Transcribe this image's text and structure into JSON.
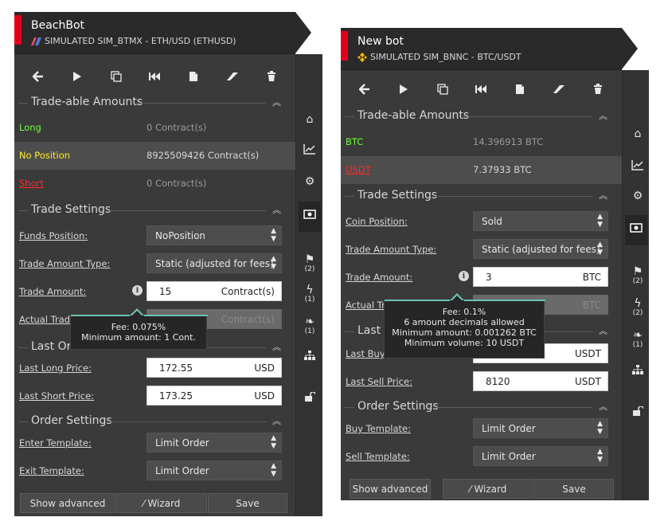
{
  "panels": [
    {
      "title": "BeachBot",
      "exchange": "SIMULATED SIM_BTMX - ETH/USD (ETHUSD)",
      "sections": {
        "amounts": "Trade-able Amounts",
        "settings": "Trade Settings",
        "last": "Last Order",
        "orders": "Order Settings"
      },
      "amounts": [
        {
          "label": "Long",
          "value": "0 Contract(s)",
          "color": "#6dff3a"
        },
        {
          "label": "No Position",
          "value": "8925509426 Contract(s)",
          "color": "#ffef28"
        },
        {
          "label": "Short",
          "value": "0 Contract(s)",
          "color": "#ff2a2a"
        }
      ],
      "fields": {
        "funds_position_label": "Funds Position:",
        "funds_position_value": "NoPosition",
        "trade_amount_type_label": "Trade Amount Type:",
        "trade_amount_type_value": "Static (adjusted for fees)",
        "trade_amount_label": "Trade Amount:",
        "trade_amount_value": "15",
        "trade_amount_unit": "Contract(s)",
        "actual_trade_label": "Actual Trade",
        "actual_trade_unit": "Contract(s)",
        "last_long_label": "Last Long Price:",
        "last_long_value": "172.55",
        "last_long_unit": "USD",
        "last_short_label": "Last Short Price:",
        "last_short_value": "173.25",
        "last_short_unit": "USD",
        "enter_template_label": "Enter Template:",
        "enter_template_value": "Limit Order",
        "exit_template_label": "Exit Template:",
        "exit_template_value": "Limit Order"
      },
      "tooltip": {
        "line1": "Fee: 0.075%",
        "line2": "Minimum amount: 1 Cont."
      },
      "buttons": {
        "advanced": "Show advanced",
        "wizard": "Wizard",
        "save": "Save"
      }
    },
    {
      "title": "New bot",
      "exchange": "SIMULATED SIM_BNNC - BTC/USDT",
      "sections": {
        "amounts": "Trade-able Amounts",
        "settings": "Trade Settings",
        "last": "Last",
        "orders": "Order Settings"
      },
      "amounts": [
        {
          "label": "BTC",
          "value": "14.396913 BTC",
          "color": "#6dff3a"
        },
        {
          "label": "USDT",
          "value": "7.37933 BTC",
          "color": "#ff2a2a"
        }
      ],
      "fields": {
        "coin_position_label": "Coin Position:",
        "coin_position_value": "Sold",
        "trade_amount_type_label": "Trade Amount Type:",
        "trade_amount_type_value": "Static (adjusted for fees)",
        "trade_amount_label": "Trade Amount:",
        "trade_amount_value": "3",
        "trade_amount_unit": "BTC",
        "actual_trade_label": "Actual Tr",
        "actual_trade_unit": "BTC",
        "last_buy_label": "Last Buy",
        "last_buy_unit": "USDT",
        "last_sell_label": "Last Sell Price:",
        "last_sell_value": "8120",
        "last_sell_unit": "USDT",
        "buy_template_label": "Buy Template:",
        "buy_template_value": "Limit Order",
        "sell_template_label": "Sell Template:",
        "sell_template_value": "Limit Order"
      },
      "tooltip": {
        "line1": "Fee: 0.1%",
        "line2": "6 amount decimals allowed",
        "line3": "Minimum amount: 0.001262 BTC",
        "line4": "Minimum volume: 10 USDT"
      },
      "buttons": {
        "advanced": "Show advanced",
        "wizard": "Wizard",
        "save": "Save"
      }
    }
  ],
  "side_nav": {
    "backtests_count": "(2)",
    "p1_flash_count": "(1)",
    "p1_leaf_count": "(1)",
    "p2_flash_count": "(2)",
    "p2_leaf_count": "(1)"
  },
  "icons": {
    "toolbar": [
      "arrow-left-icon",
      "play-icon",
      "copy-icon",
      "skip-back-icon",
      "file-icon",
      "eraser-icon",
      "trash-icon"
    ],
    "side": [
      "home-icon",
      "chart-line-icon",
      "gears-icon",
      "money-icon",
      "flag-icon",
      "flash-icon",
      "leaf-icon",
      "sitemap-icon",
      "unlock-icon"
    ]
  },
  "colors": {
    "accent_red": "#e3001b",
    "tooltip_accent": "#6fc1b2",
    "long_green": "#6dff3a",
    "no_position_yellow": "#ffef28",
    "short_red": "#ff2a2a"
  }
}
